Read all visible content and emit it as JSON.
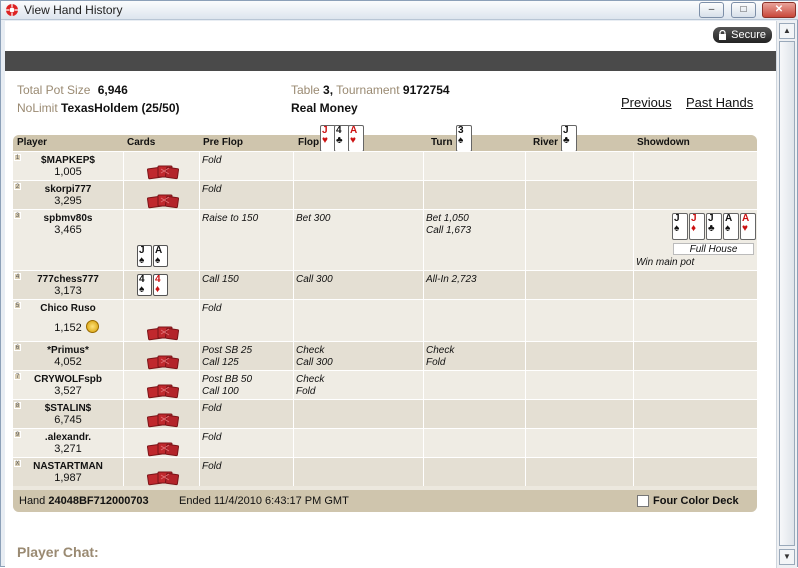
{
  "window": {
    "title": "View Hand History",
    "minimize": "‒",
    "maximize": "□",
    "close": "✕"
  },
  "secure_label": "Secure",
  "summary": {
    "total_pot_label": "Total Pot Size",
    "total_pot_value": "6,946",
    "game_type_label": "NoLimit",
    "game_type_value": "TexasHoldem (25/50)",
    "table_label": "Table",
    "table_value": "3,",
    "tournament_label": "Tournament",
    "tournament_value": "9172754",
    "money_value": "Real Money"
  },
  "nav": {
    "previous": "Previous",
    "past_hands": "Past Hands"
  },
  "columns": [
    "Player",
    "Cards",
    "Pre Flop",
    "Flop",
    "Turn",
    "River",
    "Showdown"
  ],
  "board": {
    "flop": [
      {
        "rank": "J",
        "suit": "♥",
        "color": "red"
      },
      {
        "rank": "4",
        "suit": "♣",
        "color": "black"
      },
      {
        "rank": "A",
        "suit": "♥",
        "color": "red"
      }
    ],
    "turn": [
      {
        "rank": "3",
        "suit": "♠",
        "color": "black"
      }
    ],
    "river": [
      {
        "rank": "J",
        "suit": "♣",
        "color": "black"
      }
    ]
  },
  "players": [
    {
      "seat": "1",
      "name": "$MAPKEP$",
      "chips": "1,005",
      "preflop": "Fold",
      "flop": "",
      "turn": "",
      "river": ""
    },
    {
      "seat": "2",
      "name": "skorpi777",
      "chips": "3,295",
      "preflop": "Fold",
      "flop": "",
      "turn": "",
      "river": ""
    },
    {
      "seat": "3",
      "name": "spbmv80s",
      "chips": "3,465",
      "preflop": "Raise to 150",
      "flop": "Bet 300",
      "turn": "Bet 1,050\nCall 1,673",
      "river": ""
    },
    {
      "seat": "4",
      "name": "777chess777",
      "chips": "3,173",
      "preflop": "Call 150",
      "flop": "Call 300",
      "turn": "All-In 2,723",
      "river": ""
    },
    {
      "seat": "5",
      "name": "Chico Ruso",
      "chips": "1,152",
      "preflop": "Fold",
      "flop": "",
      "turn": "",
      "river": ""
    },
    {
      "seat": "6",
      "name": "*Primus*",
      "chips": "4,052",
      "preflop": "Post SB 25\nCall 125",
      "flop": "Check\nCall 300",
      "turn": "Check\nFold",
      "river": ""
    },
    {
      "seat": "7",
      "name": "CRYWOLFspb",
      "chips": "3,527",
      "preflop": "Post BB 50\nCall 100",
      "flop": "Check\nFold",
      "turn": "",
      "river": ""
    },
    {
      "seat": "8",
      "name": "$STALIN$",
      "chips": "6,745",
      "preflop": "Fold",
      "flop": "",
      "turn": "",
      "river": ""
    },
    {
      "seat": "9",
      "name": ".alexandr.",
      "chips": "3,271",
      "preflop": "Fold",
      "flop": "",
      "turn": "",
      "river": ""
    },
    {
      "seat": "X",
      "name": "NASTARTMAN",
      "chips": "1,987",
      "preflop": "Fold",
      "flop": "",
      "turn": "",
      "river": ""
    }
  ],
  "hole_cards": {
    "spbmv80s": [
      {
        "rank": "J",
        "suit": "♠",
        "color": "black"
      },
      {
        "rank": "A",
        "suit": "♠",
        "color": "black"
      }
    ],
    "777chess777": [
      {
        "rank": "4",
        "suit": "♠",
        "color": "black"
      },
      {
        "rank": "4",
        "suit": "♦",
        "color": "red"
      }
    ]
  },
  "showdown": {
    "cards": [
      {
        "rank": "J",
        "suit": "♠",
        "color": "black"
      },
      {
        "rank": "J",
        "suit": "♦",
        "color": "red"
      },
      {
        "rank": "J",
        "suit": "♣",
        "color": "black"
      },
      {
        "rank": "A",
        "suit": "♠",
        "color": "black"
      },
      {
        "rank": "A",
        "suit": "♥",
        "color": "red"
      }
    ],
    "hand_name": "Full House",
    "result": "Win main pot"
  },
  "footer": {
    "hand_label": "Hand",
    "hand_id": "24048BF712000703",
    "ended_label": "Ended",
    "ended_value": "11/4/2010 6:43:17 PM GMT",
    "four_color_label": "Four Color Deck",
    "four_color_checked": false
  },
  "chat_label": "Player Chat:",
  "colors": {
    "header_band": "#cfc5ad",
    "label_text": "#9a8a72",
    "dark_bar": "#4a4a4a",
    "card_back": "#c0282d"
  }
}
